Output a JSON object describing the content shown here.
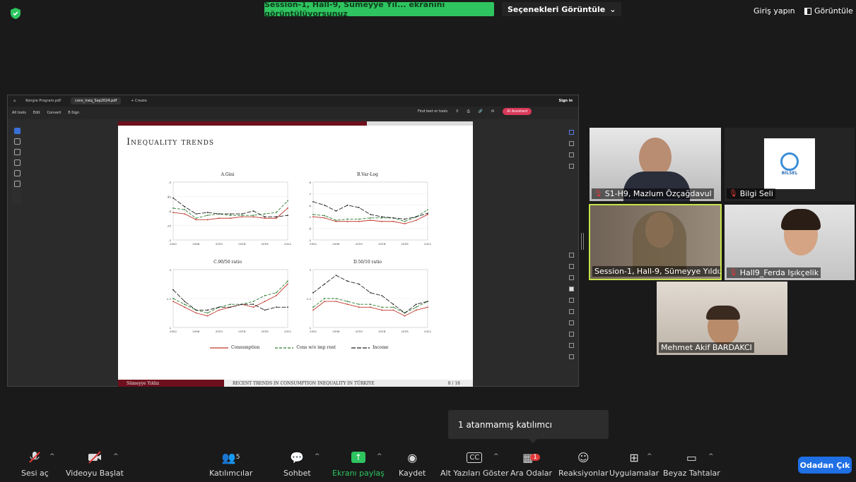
{
  "top_bar": {
    "share_banner": "Session-1, Hall-9, Sümeyye Yıl... ekranını görüntülüyorsunuz",
    "view_options": "Seçenekleri Görüntüle",
    "signin": "Giriş yapın",
    "view_button": "Görüntüle",
    "colors": {
      "banner": "#2ec45f",
      "shield": "#2ec45f"
    }
  },
  "pdf": {
    "tabs": [
      "Kongre Program.pdf",
      "cons_ineq_Sep2024.pdf",
      "+ Create"
    ],
    "menu": [
      "All tools",
      "Edit",
      "Convert",
      "E-Sign"
    ],
    "find": "Find text or tools",
    "signin": "Sign in",
    "ai_button": "AI Assistant",
    "slide_title": "Inequality trends",
    "footer_author": "Sümeyye Yıldız",
    "footer_title": "RECENT TRENDS IN CONSUMPTION INEQUALITY IN TÜRKIYE",
    "footer_page": "8 / 18",
    "legend": [
      "Consumption",
      "Cons w/o imp rent",
      "Income"
    ]
  },
  "chart_data": [
    {
      "type": "line",
      "title": "A.Gini",
      "x": [
        2002,
        2004,
        2006,
        2008,
        2010,
        2012,
        2014,
        2016,
        2018,
        2020,
        2022
      ],
      "xticks": [
        "2002",
        "2006",
        "2010",
        "2014",
        "2018",
        "2022"
      ],
      "yticks": [
        ".3",
        ".35",
        ".4",
        ".45",
        ".5"
      ],
      "ylim": [
        0.3,
        0.5
      ],
      "series": [
        {
          "name": "Consumption",
          "values": [
            0.395,
            0.39,
            0.37,
            0.37,
            0.375,
            0.375,
            0.38,
            0.38,
            0.375,
            0.375,
            0.41
          ]
        },
        {
          "name": "Cons w/o imp rent",
          "values": [
            0.41,
            0.405,
            0.375,
            0.385,
            0.39,
            0.385,
            0.385,
            0.385,
            0.39,
            0.395,
            0.435
          ]
        },
        {
          "name": "Income",
          "values": [
            0.445,
            0.415,
            0.39,
            0.395,
            0.39,
            0.39,
            0.39,
            0.4,
            0.38,
            0.38,
            0.385
          ]
        }
      ]
    },
    {
      "type": "line",
      "title": "B.Var-Log",
      "x": [
        2002,
        2004,
        2006,
        2008,
        2010,
        2012,
        2014,
        2016,
        2018,
        2020,
        2022
      ],
      "xticks": [
        "2002",
        "2006",
        "2010",
        "2014",
        "2018",
        "2022"
      ],
      "yticks": [
        ".3",
        ".4",
        ".5",
        ".6",
        ".7",
        ".8"
      ],
      "ylim": [
        0.3,
        0.8
      ],
      "series": [
        {
          "name": "Consumption",
          "values": [
            0.5,
            0.49,
            0.46,
            0.46,
            0.46,
            0.47,
            0.46,
            0.46,
            0.44,
            0.47,
            0.52
          ]
        },
        {
          "name": "Cons w/o imp rent",
          "values": [
            0.52,
            0.51,
            0.47,
            0.48,
            0.48,
            0.49,
            0.49,
            0.49,
            0.46,
            0.5,
            0.56
          ]
        },
        {
          "name": "Income",
          "values": [
            0.63,
            0.6,
            0.55,
            0.6,
            0.58,
            0.52,
            0.5,
            0.49,
            0.48,
            0.5,
            0.53
          ]
        }
      ]
    },
    {
      "type": "line",
      "title": "C.90/50 ratio",
      "x": [
        2002,
        2004,
        2006,
        2008,
        2010,
        2012,
        2014,
        2016,
        2018,
        2020,
        2022
      ],
      "xticks": [
        "2002",
        "2006",
        "2010",
        "2014",
        "2018",
        "2022"
      ],
      "yticks": [
        "2",
        "2.5",
        "3"
      ],
      "ylim": [
        2,
        3
      ],
      "series": [
        {
          "name": "Consumption",
          "values": [
            2.45,
            2.35,
            2.25,
            2.2,
            2.3,
            2.35,
            2.4,
            2.35,
            2.45,
            2.55,
            2.75
          ]
        },
        {
          "name": "Cons w/o imp rent",
          "values": [
            2.5,
            2.4,
            2.3,
            2.25,
            2.35,
            2.4,
            2.4,
            2.45,
            2.55,
            2.6,
            2.8
          ]
        },
        {
          "name": "Income",
          "values": [
            2.65,
            2.45,
            2.3,
            2.3,
            2.35,
            2.35,
            2.4,
            2.4,
            2.3,
            2.35,
            2.35
          ]
        }
      ]
    },
    {
      "type": "line",
      "title": "D.50/10 ratio",
      "x": [
        2002,
        2004,
        2006,
        2008,
        2010,
        2012,
        2014,
        2016,
        2018,
        2020,
        2022
      ],
      "xticks": [
        "2002",
        "2006",
        "2010",
        "2014",
        "2018",
        "2022"
      ],
      "yticks": [
        "2",
        "2.5",
        "3"
      ],
      "ylim": [
        2,
        3
      ],
      "series": [
        {
          "name": "Consumption",
          "values": [
            2.3,
            2.45,
            2.45,
            2.4,
            2.35,
            2.35,
            2.3,
            2.3,
            2.2,
            2.3,
            2.35
          ]
        },
        {
          "name": "Cons w/o imp rent",
          "values": [
            2.35,
            2.5,
            2.5,
            2.45,
            2.4,
            2.4,
            2.35,
            2.35,
            2.25,
            2.35,
            2.45
          ]
        },
        {
          "name": "Income",
          "values": [
            2.6,
            2.75,
            2.9,
            2.8,
            2.75,
            2.6,
            2.55,
            2.4,
            2.25,
            2.4,
            2.45
          ]
        }
      ]
    }
  ],
  "participants": [
    {
      "name": "S1-H9, Mazlum Özçağdavul",
      "muted": true
    },
    {
      "name": "Bilgi Seli",
      "muted": true,
      "logo": "BİLSEL"
    },
    {
      "name": "Session-1, Hall-9, Sümeyye Yıldız",
      "muted": false
    },
    {
      "name": "Hall9_Ferda Işıkçelik",
      "muted": true
    },
    {
      "name": "Mehmet Akif BARDAKCI",
      "muted": false
    }
  ],
  "tooltip": "1 atanmamış katılımcı",
  "toolbar": {
    "audio": "Sesi aç",
    "video": "Videoyu Başlat",
    "participants": "Katılımcılar",
    "participants_count": "5",
    "chat": "Sohbet",
    "share": "Ekranı paylaş",
    "record": "Kaydet",
    "captions": "Alt Yazıları Göster",
    "rooms": "Ara Odalar",
    "rooms_badge": "1",
    "reactions": "Reaksiyonlar",
    "apps": "Uygulamalar",
    "whiteboard": "Beyaz Tahtalar",
    "leave": "Odadan Çık",
    "colors": {
      "share": "#2ec45f",
      "leave": "#1f6fe5",
      "mute": "#e03a3a"
    }
  }
}
